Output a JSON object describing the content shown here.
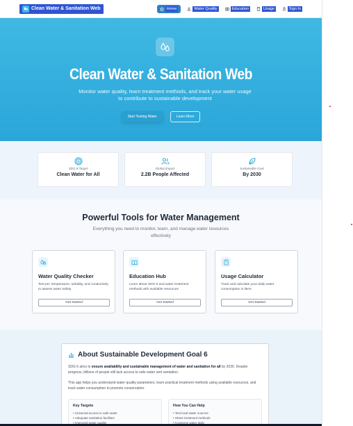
{
  "nav": {
    "brand": "Clean Water & Sanitation Web",
    "links": [
      {
        "label": "Home",
        "icon": "home-icon",
        "active": true
      },
      {
        "label": "Water Quality",
        "icon": "flask-icon",
        "active": false
      },
      {
        "label": "Education",
        "icon": "book-icon",
        "active": false
      },
      {
        "label": "Usage",
        "icon": "calculator-icon",
        "active": false
      },
      {
        "label": "Sign In",
        "icon": "user-icon",
        "active": false
      }
    ]
  },
  "hero": {
    "icon": "water-droplets-icon",
    "title": "Clean Water & Sanitation Web",
    "subtitle": "Monitor water quality, learn treatment methods, and track your water usage to contribute to sustainable development",
    "primary_button": "Start Testing Water",
    "secondary_button": "Learn More"
  },
  "stats": [
    {
      "icon": "target-icon",
      "label": "SDG 6 Target",
      "value": "Clean Water for All"
    },
    {
      "icon": "users-icon",
      "label": "Global Impact",
      "value": "2.2B People Affected"
    },
    {
      "icon": "leaf-icon",
      "label": "Sustainable Goal",
      "value": "By 2030"
    }
  ],
  "tools": {
    "title": "Powerful Tools for Water Management",
    "subtitle": "Everything you need to monitor, learn, and manage water resources effectively",
    "cards": [
      {
        "icon": "droplets-icon",
        "title": "Water Quality Checker",
        "description": "Test pH, temperature, turbidity, and conductivity to assess water safety",
        "button": "Get Started"
      },
      {
        "icon": "book-icon",
        "title": "Education Hub",
        "description": "Learn about SDG 6 and water treatment methods with available resources",
        "button": "Get Started"
      },
      {
        "icon": "calculator-icon",
        "title": "Usage Calculator",
        "description": "Track and calculate your daily water consumption in liters",
        "button": "Get Started"
      }
    ]
  },
  "about": {
    "icon": "bar-chart-icon",
    "title": "About Sustainable Development Goal 6",
    "p1_pre": "SDG 6 aims to ",
    "p1_bold": "ensure availability and sustainable management of water and sanitation for all",
    "p1_post": " by 2030. Despite progress, billions of people still lack access to safe water and sanitation.",
    "p2": "This app helps you understand water quality parameters, learn practical treatment methods using available resources, and track water consumption to promote conservation.",
    "targets": {
      "heading": "Key Targets",
      "items": [
        "• Universal access to safe water",
        "• Adequate sanitation facilities",
        "• Improved water quality"
      ]
    },
    "help": {
      "heading": "How You Can Help",
      "items": [
        "• Test local water sources",
        "• Share treatment methods",
        "• Conserve water daily"
      ]
    }
  }
}
